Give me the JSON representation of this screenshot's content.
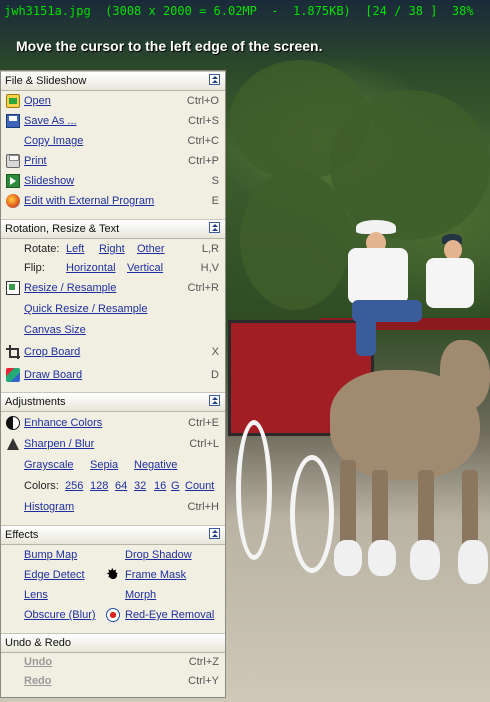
{
  "topbar": {
    "file_info": "jwh3151a.jpg  (3008 x 2000 = 6.02MP  -  1.875KB)  [24 / 38 ]  38%",
    "hint": "Move the cursor to the left edge of the screen."
  },
  "sections": {
    "file": {
      "title": "File & Slideshow",
      "open": "Open",
      "open_key": "Ctrl+O",
      "save_as": "Save As ...",
      "save_as_key": "Ctrl+S",
      "copy_image": "Copy Image",
      "copy_image_key": "Ctrl+C",
      "print": "Print",
      "print_key": "Ctrl+P",
      "slideshow": "Slideshow",
      "slideshow_key": "S",
      "external": "Edit with External Program",
      "external_key": "E"
    },
    "rotation": {
      "title": "Rotation, Resize & Text",
      "rotate_label": "Rotate:",
      "rotate_left": "Left",
      "rotate_right": "Right",
      "rotate_other": "Other",
      "rotate_key": "L,R",
      "flip_label": "Flip:",
      "flip_horizontal": "Horizontal",
      "flip_vertical": "Vertical",
      "flip_key": "H,V",
      "resize": "Resize / Resample",
      "resize_key": "Ctrl+R",
      "quick_resize": "Quick Resize / Resample",
      "canvas_size": "Canvas Size",
      "crop_board": "Crop Board",
      "crop_key": "X",
      "draw_board": "Draw Board",
      "draw_key": "D"
    },
    "adjustments": {
      "title": "Adjustments",
      "enhance": "Enhance Colors",
      "enhance_key": "Ctrl+E",
      "sharpen": "Sharpen / Blur",
      "sharpen_key": "Ctrl+L",
      "grayscale": "Grayscale",
      "sepia": "Sepia",
      "negative": "Negative",
      "colors_label": "Colors:",
      "colors": [
        "256",
        "128",
        "64",
        "32",
        "16",
        "G",
        "Count"
      ],
      "histogram": "Histogram",
      "histogram_key": "Ctrl+H"
    },
    "effects": {
      "title": "Effects",
      "bump_map": "Bump Map",
      "drop_shadow": "Drop Shadow",
      "edge_detect": "Edge Detect",
      "frame_mask": "Frame Mask",
      "lens": "Lens",
      "morph": "Morph",
      "obscure": "Obscure (Blur)",
      "red_eye": "Red-Eye Removal"
    },
    "undo": {
      "title": "Undo & Redo",
      "undo": "Undo",
      "undo_key": "Ctrl+Z",
      "redo": "Redo",
      "redo_key": "Ctrl+Y"
    }
  }
}
